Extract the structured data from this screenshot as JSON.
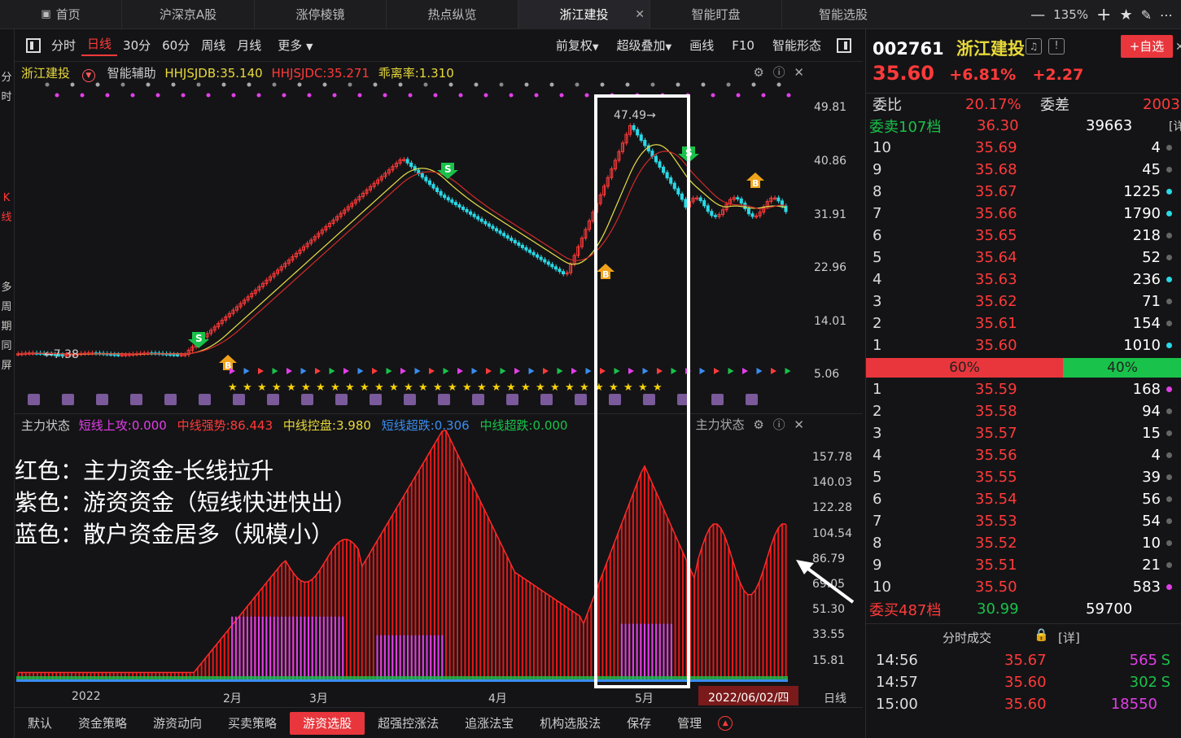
{
  "top_tabs": [
    {
      "label": "首页",
      "icon": "home-icon"
    },
    {
      "label": "沪深京A股"
    },
    {
      "label": "涨停棱镜"
    },
    {
      "label": "热点纵览"
    },
    {
      "label": "浙江建投",
      "active": true
    },
    {
      "label": "智能盯盘"
    },
    {
      "label": "智能选股"
    }
  ],
  "window": {
    "zoom": "135%",
    "minus": "—",
    "plus": "+"
  },
  "left_strip": {
    "items": [
      "分",
      "时",
      "K",
      "线",
      "多",
      "周",
      "期",
      "同",
      "屏"
    ]
  },
  "toolbar": {
    "left": [
      "分时",
      "日线",
      "30分",
      "60分",
      "周线",
      "月线",
      "更多"
    ],
    "active": "日线",
    "right": [
      "前复权",
      "超级叠加",
      "画线",
      "F10",
      "智能形态"
    ]
  },
  "main_legend": {
    "name": "浙江建投",
    "assist": "智能辅助",
    "hhjsjdb": "HHJSJDB:35.140",
    "hhjsjdc": "HHJSJDC:35.271",
    "deviation": "乖离率:1.310"
  },
  "main_yaxis": [
    "49.81",
    "40.86",
    "31.91",
    "22.96",
    "14.01",
    "5.06"
  ],
  "main_annotations": {
    "high": "47.49→",
    "low": "←7.38",
    "buy": "B",
    "sell": "S"
  },
  "sub_legend": {
    "title": "主力状态",
    "short_attack": "短线上攻:0.000",
    "mid_strong": "中线强势:86.443",
    "mid_control": "中线控盘:3.980",
    "short_drop": "短线超跌:0.306",
    "mid_drop": "中线超跌:0.000",
    "right_title": "主力状态"
  },
  "sub_yaxis": [
    "157.78",
    "140.03",
    "122.28",
    "104.54",
    "86.79",
    "69.05",
    "51.30",
    "33.55",
    "15.81"
  ],
  "sub_notes": [
    "红色：主力资金-长线拉升",
    "紫色：游资资金（短线快进快出）",
    "蓝色：散户资金居多（规模小）"
  ],
  "xaxis": {
    "labels": [
      "2022",
      "2月",
      "3月",
      "4月",
      "5月"
    ],
    "date": "2022/06/02/四",
    "period": "日线"
  },
  "bottom_tabs": [
    "默认",
    "资金策略",
    "游资动向",
    "买卖策略",
    "游资选股",
    "超强控涨法",
    "追涨法宝",
    "机构选股法",
    "保存",
    "管理"
  ],
  "bottom_active": "游资选股",
  "stock": {
    "code": "002761",
    "name": "浙江建投",
    "price": "35.60",
    "pct": "+6.81%",
    "change": "+2.27",
    "add_watch": "+自选",
    "weibi_label": "委比",
    "weibi": "20.17%",
    "weicha_label": "委差",
    "weicha": "2003",
    "sell_total_label": "委卖107档",
    "sell_total_price": "36.30",
    "sell_total_vol": "39663",
    "detail": "[详",
    "buy_total_label": "委买487档",
    "buy_total_price": "30.99",
    "buy_total_vol": "59700",
    "ratio_sell": "60%",
    "ratio_buy": "40%"
  },
  "asks": [
    {
      "i": "10",
      "p": "35.69",
      "v": "4",
      "dot": "gray"
    },
    {
      "i": "9",
      "p": "35.68",
      "v": "45",
      "dot": "gray"
    },
    {
      "i": "8",
      "p": "35.67",
      "v": "1225",
      "dot": "cyan"
    },
    {
      "i": "7",
      "p": "35.66",
      "v": "1790",
      "dot": "cyan"
    },
    {
      "i": "6",
      "p": "35.65",
      "v": "218",
      "dot": "gray"
    },
    {
      "i": "5",
      "p": "35.64",
      "v": "52",
      "dot": "gray"
    },
    {
      "i": "4",
      "p": "35.63",
      "v": "236",
      "dot": "cyan"
    },
    {
      "i": "3",
      "p": "35.62",
      "v": "71",
      "dot": "gray"
    },
    {
      "i": "2",
      "p": "35.61",
      "v": "154",
      "dot": "gray"
    },
    {
      "i": "1",
      "p": "35.60",
      "v": "1010",
      "dot": "cyan"
    }
  ],
  "bids": [
    {
      "i": "1",
      "p": "35.59",
      "v": "168",
      "dot": "mag"
    },
    {
      "i": "2",
      "p": "35.58",
      "v": "94",
      "dot": "gray"
    },
    {
      "i": "3",
      "p": "35.57",
      "v": "15",
      "dot": "gray"
    },
    {
      "i": "4",
      "p": "35.56",
      "v": "4",
      "dot": "gray"
    },
    {
      "i": "5",
      "p": "35.55",
      "v": "39",
      "dot": "gray"
    },
    {
      "i": "6",
      "p": "35.54",
      "v": "56",
      "dot": "gray"
    },
    {
      "i": "7",
      "p": "35.53",
      "v": "54",
      "dot": "gray"
    },
    {
      "i": "8",
      "p": "35.52",
      "v": "10",
      "dot": "gray"
    },
    {
      "i": "9",
      "p": "35.51",
      "v": "21",
      "dot": "gray"
    },
    {
      "i": "10",
      "p": "35.50",
      "v": "583",
      "dot": "mag"
    }
  ],
  "ticks_title": "分时成交",
  "ticks_detail": "[详]",
  "ticks": [
    {
      "t": "14:56",
      "p": "35.67",
      "v": "565",
      "s": "S",
      "vc": "mag"
    },
    {
      "t": "14:57",
      "p": "35.60",
      "v": "302",
      "s": "S",
      "vc": "green"
    },
    {
      "t": "15:00",
      "p": "35.60",
      "v": "18550",
      "s": "",
      "vc": "mag"
    }
  ],
  "colors": {
    "up": "#ff3a3a",
    "down": "#2ad9e6",
    "bg": "#141416",
    "ma1": "#e8e04a",
    "ma2": "#d22a2a"
  }
}
